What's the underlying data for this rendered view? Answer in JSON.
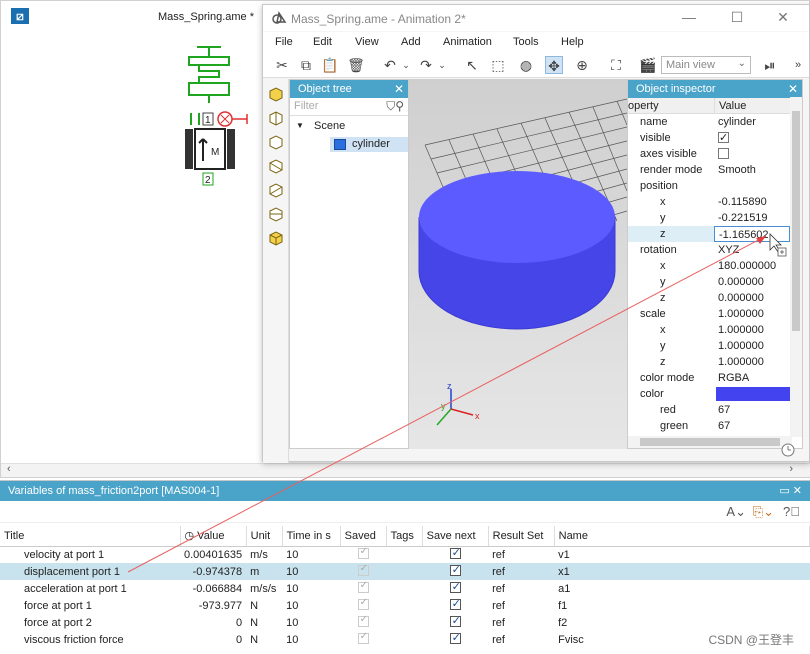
{
  "main_window": {
    "title": "Mass_Spring.ame *"
  },
  "sketch": {
    "port_top": "1",
    "port_bottom": "2",
    "mass_label": "M"
  },
  "anim_window": {
    "title": "Mass_Spring.ame - Animation 2*",
    "menu": [
      "File",
      "Edit",
      "View",
      "Add",
      "Animation",
      "Tools",
      "Help"
    ],
    "view_select": "Main view"
  },
  "object_tree": {
    "title": "Object tree",
    "filter_placeholder": "Filter",
    "scene_label": "Scene",
    "items": [
      "cylinder"
    ]
  },
  "object_inspector": {
    "title": "Object inspector",
    "col_property": "operty",
    "col_value": "Value",
    "rows": {
      "name": {
        "label": "name",
        "value": "cylinder"
      },
      "visible": {
        "label": "visible",
        "checked": true
      },
      "axes_visible": {
        "label": "axes visible",
        "checked": false
      },
      "render_mode": {
        "label": "render mode",
        "value": "Smooth"
      },
      "position": {
        "label": "position"
      },
      "pos_x": {
        "label": "x",
        "value": "-0.115890"
      },
      "pos_y": {
        "label": "y",
        "value": "-0.221519"
      },
      "pos_z": {
        "label": "z",
        "value": "-1.165602"
      },
      "rotation": {
        "label": "rotation",
        "value": "XYZ"
      },
      "rot_x": {
        "label": "x",
        "value": "180.000000"
      },
      "rot_y": {
        "label": "y",
        "value": "0.000000"
      },
      "rot_z": {
        "label": "z",
        "value": "0.000000"
      },
      "scale": {
        "label": "scale",
        "value": "1.000000"
      },
      "sc_x": {
        "label": "x",
        "value": "1.000000"
      },
      "sc_y": {
        "label": "y",
        "value": "1.000000"
      },
      "sc_z": {
        "label": "z",
        "value": "1.000000"
      },
      "color_mode": {
        "label": "color mode",
        "value": "RGBA"
      },
      "color": {
        "label": "color",
        "swatch": "#4343ef"
      },
      "red": {
        "label": "red",
        "value": "67"
      },
      "green": {
        "label": "green",
        "value": "67"
      }
    }
  },
  "axes": {
    "x": "x",
    "y": "y",
    "z": "z"
  },
  "variables": {
    "title": "Variables of mass_friction2port [MAS004-1]",
    "header_controls": "▭ ✕",
    "columns": [
      "Title",
      "Value",
      "Unit",
      "Time in s",
      "Saved",
      "Tags",
      "Save next",
      "Result Set",
      "Name"
    ],
    "rows": [
      {
        "title": "velocity at port 1",
        "value": "0.00401635",
        "unit": "m/s",
        "time": "10",
        "result_set": "ref",
        "name": "v1",
        "selected": false
      },
      {
        "title": "displacement port 1",
        "value": "-0.974378",
        "unit": "m",
        "time": "10",
        "result_set": "ref",
        "name": "x1",
        "selected": true
      },
      {
        "title": "acceleration at port 1",
        "value": "-0.066884",
        "unit": "m/s/s",
        "time": "10",
        "result_set": "ref",
        "name": "a1",
        "selected": false
      },
      {
        "title": "force at port 1",
        "value": "-973.977",
        "unit": "N",
        "time": "10",
        "result_set": "ref",
        "name": "f1",
        "selected": false
      },
      {
        "title": "force at port 2",
        "value": "0",
        "unit": "N",
        "time": "10",
        "result_set": "ref",
        "name": "f2",
        "selected": false
      },
      {
        "title": "viscous friction force",
        "value": "0",
        "unit": "N",
        "time": "10",
        "result_set": "ref",
        "name": "Fvisc",
        "selected": false
      }
    ]
  },
  "watermark": "CSDN @王登丰",
  "colors": {
    "accent": "#4aa3c8",
    "cylinder": "#4a4af0",
    "selected_row": "#c8e3ee"
  }
}
